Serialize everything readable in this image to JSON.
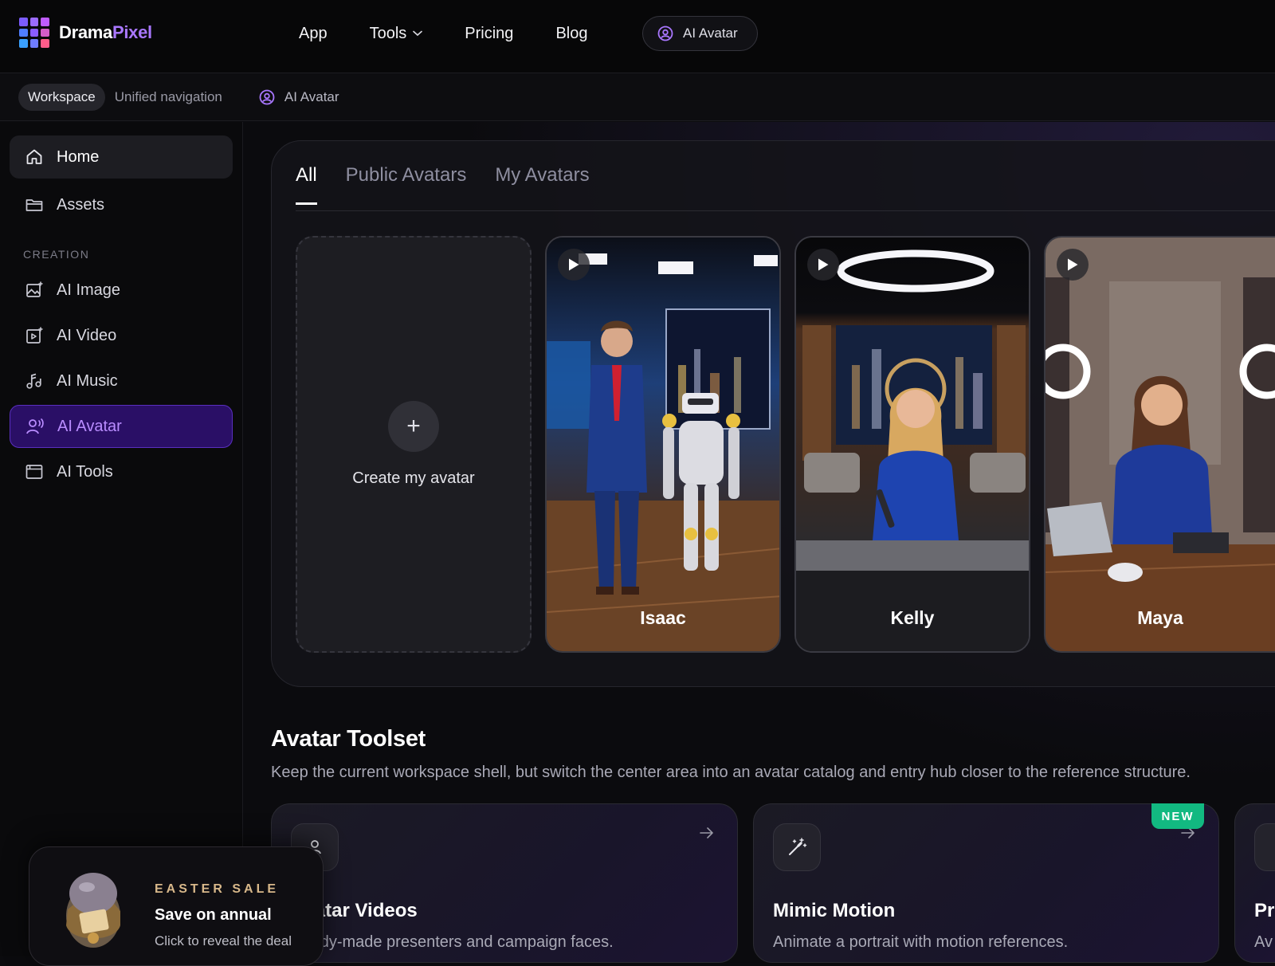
{
  "brand": {
    "part1": "Drama",
    "part2": "Pixel"
  },
  "nav": {
    "app": "App",
    "tools": "Tools",
    "pricing": "Pricing",
    "blog": "Blog",
    "ai_avatar": "AI Avatar"
  },
  "subbar": {
    "workspace": "Workspace",
    "unified": "Unified navigation",
    "crumb": "AI Avatar"
  },
  "sidebar": {
    "home": "Home",
    "assets": "Assets",
    "section": "CREATION",
    "items": [
      "AI Image",
      "AI Video",
      "AI Music",
      "AI Avatar",
      "AI Tools"
    ]
  },
  "tabs": [
    "All",
    "Public Avatars",
    "My Avatars"
  ],
  "create": {
    "label": "Create my avatar"
  },
  "avatars": [
    {
      "name": "Isaac"
    },
    {
      "name": "Kelly"
    },
    {
      "name": "Maya"
    }
  ],
  "toolset": {
    "title": "Avatar Toolset",
    "desc": "Keep the current workspace shell, but switch the center area into an avatar catalog and entry hub closer to the reference structure.",
    "cards": [
      {
        "title": "Avatar Videos",
        "desc": "Ready-made presenters and campaign faces."
      },
      {
        "title": "Mimic Motion",
        "desc": "Animate a portrait with motion references.",
        "badge": "NEW"
      },
      {
        "title": "Pr",
        "desc": "Av"
      }
    ]
  },
  "promo": {
    "kicker": "EASTER SALE",
    "title": "Save on annual",
    "sub": "Click to reveal the deal"
  },
  "colors": {
    "accent": "#a977ff",
    "active_bg": "#2a0f66",
    "new_badge": "#12b981"
  }
}
